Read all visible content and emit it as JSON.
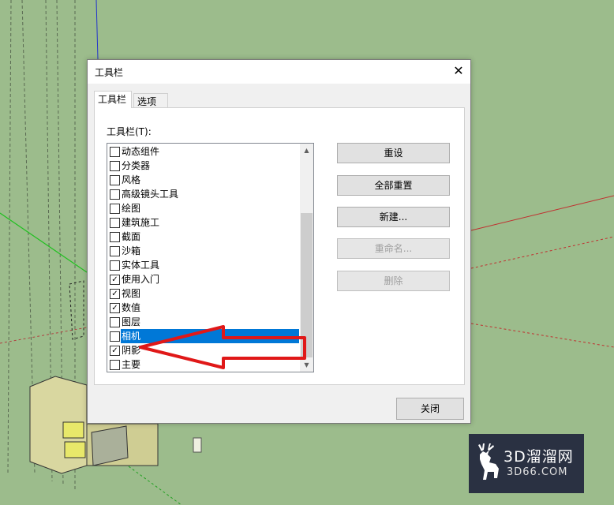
{
  "dialog": {
    "title": "工具栏",
    "close_glyph": "✕",
    "tabs": [
      {
        "label": "工具栏",
        "active": true
      },
      {
        "label": "选项",
        "active": false
      }
    ],
    "list_label": "工具栏(T):",
    "toolbars": [
      {
        "label": "动态组件",
        "checked": false
      },
      {
        "label": "分类器",
        "checked": false
      },
      {
        "label": "风格",
        "checked": false
      },
      {
        "label": "高级镜头工具",
        "checked": false
      },
      {
        "label": "绘图",
        "checked": false
      },
      {
        "label": "建筑施工",
        "checked": false
      },
      {
        "label": "截面",
        "checked": false
      },
      {
        "label": "沙箱",
        "checked": false
      },
      {
        "label": "实体工具",
        "checked": false
      },
      {
        "label": "使用入门",
        "checked": true
      },
      {
        "label": "视图",
        "checked": true
      },
      {
        "label": "数值",
        "checked": true
      },
      {
        "label": "图层",
        "checked": false
      },
      {
        "label": "相机",
        "checked": false,
        "selected": true
      },
      {
        "label": "阴影",
        "checked": true
      },
      {
        "label": "主要",
        "checked": false
      }
    ],
    "buttons": [
      {
        "label": "重设",
        "enabled": true
      },
      {
        "label": "全部重置",
        "enabled": true
      },
      {
        "label": "新建...",
        "enabled": true
      },
      {
        "label": "重命名...",
        "enabled": false
      },
      {
        "label": "删除",
        "enabled": false
      }
    ],
    "close_button": "关闭"
  },
  "watermark": {
    "text_cn": "3D溜溜网",
    "text_en": "3D66.COM",
    "icon": "deer-logo-icon"
  },
  "colors": {
    "viewport_bg": "#9cbc8c",
    "selection": "#0078d7",
    "arrow": "#e01818",
    "watermark_bg": "#2a3142"
  }
}
